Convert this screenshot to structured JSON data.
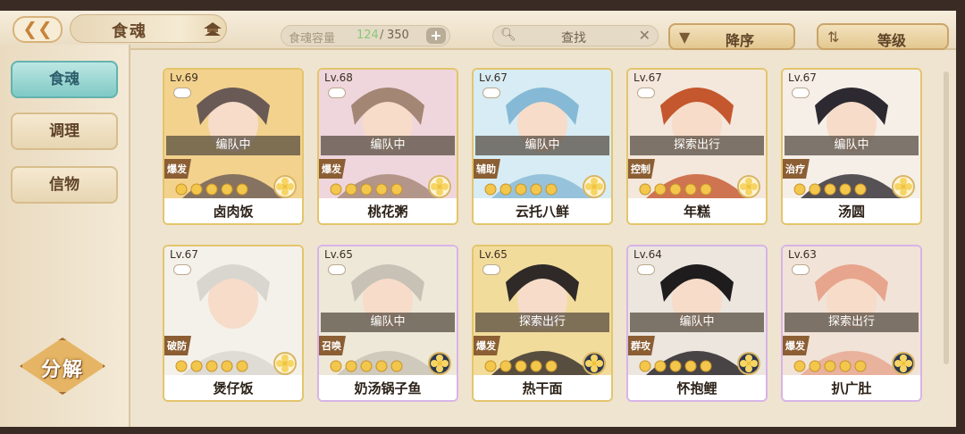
{
  "header": {
    "title": "食魂",
    "capacity_label": "食魂容量",
    "capacity_current": "124",
    "capacity_separator": "/",
    "capacity_max": "350",
    "search_label": "查找",
    "sort_desc_label": "降序",
    "sort_level_label": "等级"
  },
  "sidebar": {
    "tabs": [
      {
        "label": "食魂"
      },
      {
        "label": "调理"
      },
      {
        "label": "信物"
      }
    ],
    "decompose_label": "分解"
  },
  "cards": [
    {
      "level": "Lv.69",
      "status": "编队中",
      "role": "爆发",
      "name": "卤肉饭",
      "frame": "gold",
      "art_colors": [
        "#f3d28e",
        "#6a5a55"
      ],
      "stars": 5,
      "rank": "gold"
    },
    {
      "level": "Lv.68",
      "status": "编队中",
      "role": "爆发",
      "name": "桃花粥",
      "frame": "gold",
      "art_colors": [
        "#efd6dc",
        "#a48674"
      ],
      "stars": 5,
      "rank": "gold"
    },
    {
      "level": "Lv.67",
      "status": "编队中",
      "role": "辅助",
      "name": "云托八鲜",
      "frame": "gold",
      "art_colors": [
        "#d7ecf4",
        "#86b9d5"
      ],
      "stars": 5,
      "rank": "gold"
    },
    {
      "level": "Lv.67",
      "status": "探索出行",
      "role": "控制",
      "name": "年糕",
      "frame": "gold",
      "art_colors": [
        "#f4e7dc",
        "#c4572d"
      ],
      "stars": 5,
      "rank": "gold"
    },
    {
      "level": "Lv.67",
      "status": "编队中",
      "role": "治疗",
      "name": "汤圆",
      "frame": "gold",
      "art_colors": [
        "#f5efe8",
        "#2d2930"
      ],
      "stars": 5,
      "rank": "gold"
    },
    {
      "level": "Lv.67",
      "status": "",
      "role": "破防",
      "name": "煲仔饭",
      "frame": "gold",
      "art_colors": [
        "#f4f1ea",
        "#d9d6d0"
      ],
      "stars": 5,
      "rank": "gold"
    },
    {
      "level": "Lv.65",
      "status": "编队中",
      "role": "召唤",
      "name": "奶汤锅子鱼",
      "frame": "rainbow",
      "art_colors": [
        "#eee8d8",
        "#c7c2b5"
      ],
      "stars": 5,
      "rank": "blue"
    },
    {
      "level": "Lv.65",
      "status": "探索出行",
      "role": "爆发",
      "name": "热干面",
      "frame": "gold",
      "art_colors": [
        "#f2dc9c",
        "#2f2a28"
      ],
      "stars": 5,
      "rank": "blue"
    },
    {
      "level": "Lv.64",
      "status": "编队中",
      "role": "群攻",
      "name": "怀抱鲤",
      "frame": "rainbow",
      "art_colors": [
        "#ece6df",
        "#1f1c1e"
      ],
      "stars": 5,
      "rank": "blue"
    },
    {
      "level": "Lv.63",
      "status": "探索出行",
      "role": "爆发",
      "name": "扒广肚",
      "frame": "rainbow",
      "art_colors": [
        "#f1e3d7",
        "#e7a58d"
      ],
      "stars": 5,
      "rank": "blue"
    }
  ]
}
